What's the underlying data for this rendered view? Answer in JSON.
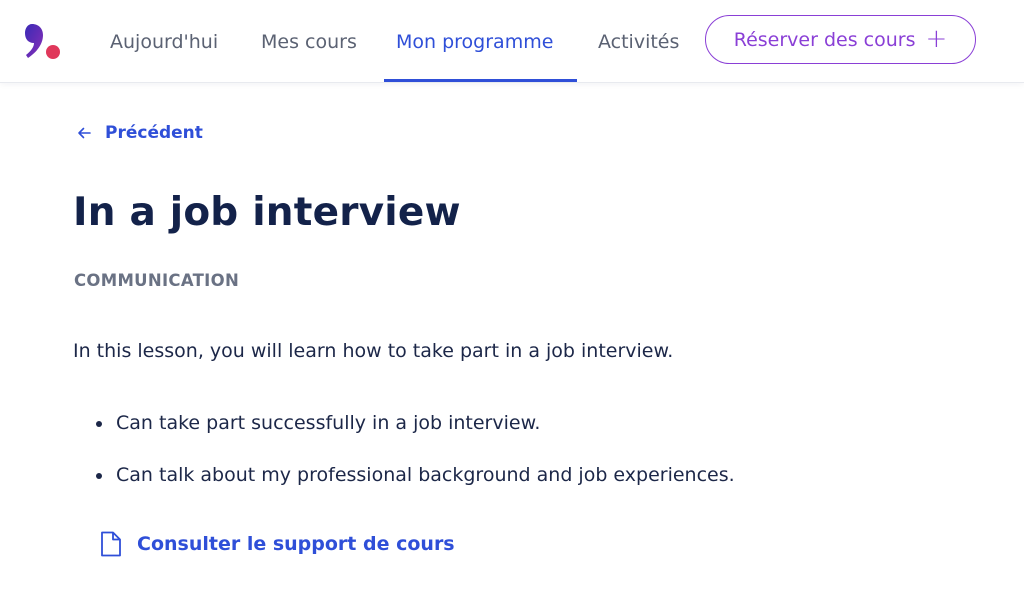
{
  "nav": {
    "items": [
      {
        "label": "Aujourd'hui",
        "active": false
      },
      {
        "label": "Mes cours",
        "active": false
      },
      {
        "label": "Mon programme",
        "active": true
      },
      {
        "label": "Activités",
        "active": false
      }
    ],
    "book_label": "Réserver des cours"
  },
  "back": {
    "label": "Précédent"
  },
  "lesson": {
    "title": "In a job interview",
    "category": "COMMUNICATION",
    "intro": "In this lesson, you will learn how to take part in a job interview.",
    "objectives": [
      "Can take part successfully in a job interview.",
      "Can talk about my professional background and job experiences."
    ],
    "support_label": "Consulter le support de cours"
  },
  "icons": {
    "logo": "comma-logo-icon",
    "back": "arrow-left-icon",
    "book": "plus-icon",
    "support": "document-icon"
  },
  "colors": {
    "accent": "#2f4fd8",
    "book": "#8a3fd6",
    "text": "#13224a",
    "muted": "#6a7284",
    "logo_dark": "#4b2bb8",
    "logo_pink": "#e0385b"
  }
}
